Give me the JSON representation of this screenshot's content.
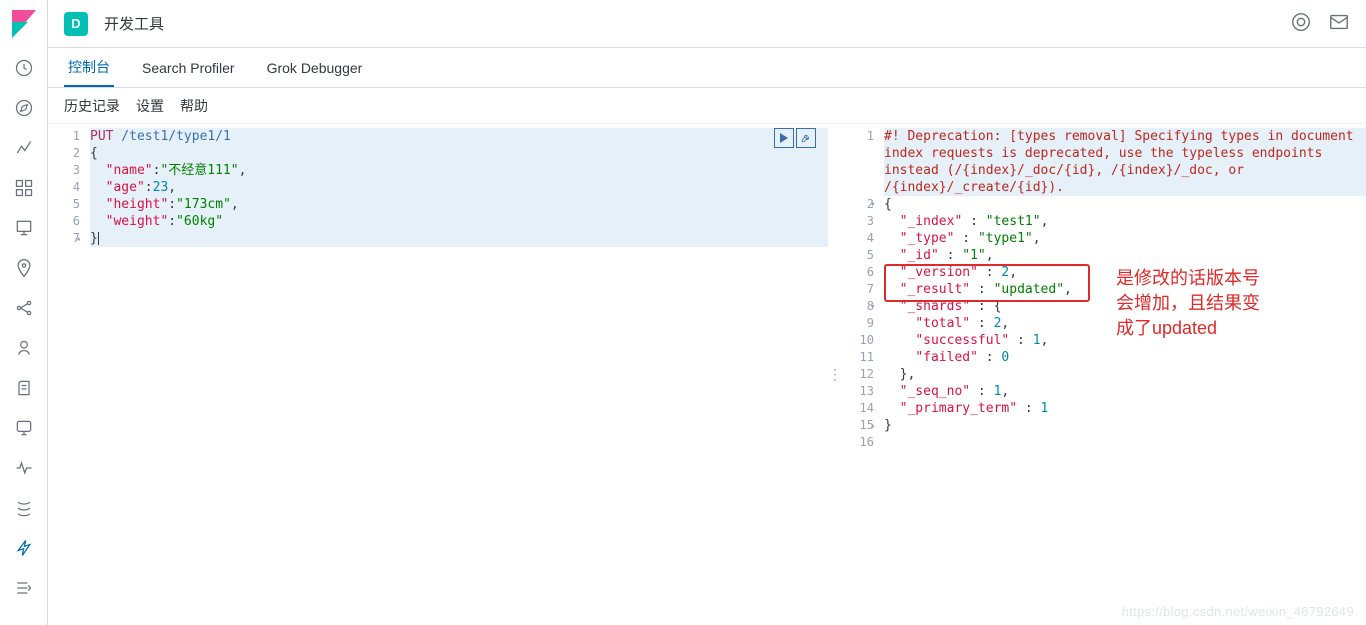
{
  "topbar": {
    "badge": "D",
    "title": "开发工具"
  },
  "tabs": [
    {
      "label": "控制台",
      "active": true
    },
    {
      "label": "Search Profiler",
      "active": false
    },
    {
      "label": "Grok Debugger",
      "active": false
    }
  ],
  "toolbar": {
    "history": "历史记录",
    "settings": "设置",
    "help": "帮助"
  },
  "request": {
    "line_numbers": [
      "1",
      "2",
      "3",
      "4",
      "5",
      "6",
      "7"
    ],
    "method": "PUT",
    "path": " /test1/type1/1",
    "open_brace": "{",
    "l3_key": "\"name\"",
    "l3_val": "\"不经意111\"",
    "l4_key": "\"age\"",
    "l4_val": "23",
    "l5_key": "\"height\"",
    "l5_val": "\"173cm\"",
    "l6_key": "\"weight\"",
    "l6_val": "\"60kg\"",
    "close_brace": "}",
    "fold_7": "▴"
  },
  "response": {
    "line_numbers": [
      "1",
      "2",
      "3",
      "4",
      "5",
      "6",
      "7",
      "8",
      "9",
      "10",
      "11",
      "12",
      "13",
      "14",
      "15",
      "16"
    ],
    "l1": "#! Deprecation: [types removal] Specifying types in document index requests is deprecated, use the typeless endpoints instead (/{index}/_doc/{id}, /{index}/_doc, or /{index}/_create/{id}).",
    "l2": "{",
    "l3_k": "\"_index\"",
    "l3_v": "\"test1\"",
    "l4_k": "\"_type\"",
    "l4_v": "\"type1\"",
    "l5_k": "\"_id\"",
    "l5_v": "\"1\"",
    "l6_k": "\"_version\"",
    "l6_v": "2",
    "l7_k": "\"_result\"",
    "l7_v": "\"updated\"",
    "l8_k": "\"_shards\"",
    "l9_k": "\"total\"",
    "l9_v": "2",
    "l10_k": "\"successful\"",
    "l10_v": "1",
    "l11_k": "\"failed\"",
    "l11_v": "0",
    "l12": "  },",
    "l13_k": "\"_seq_no\"",
    "l13_v": "1",
    "l14_k": "\"_primary_term\"",
    "l14_v": "1",
    "l15": "}",
    "fold_2": "▾",
    "fold_8": "▾",
    "fold_15": "▴"
  },
  "annotation": {
    "text_l1": "是修改的话版本号",
    "text_l2": "会增加，且结果变",
    "text_l3": "成了updated"
  },
  "watermark": "https://blog.csdn.net/weixin_46792649"
}
